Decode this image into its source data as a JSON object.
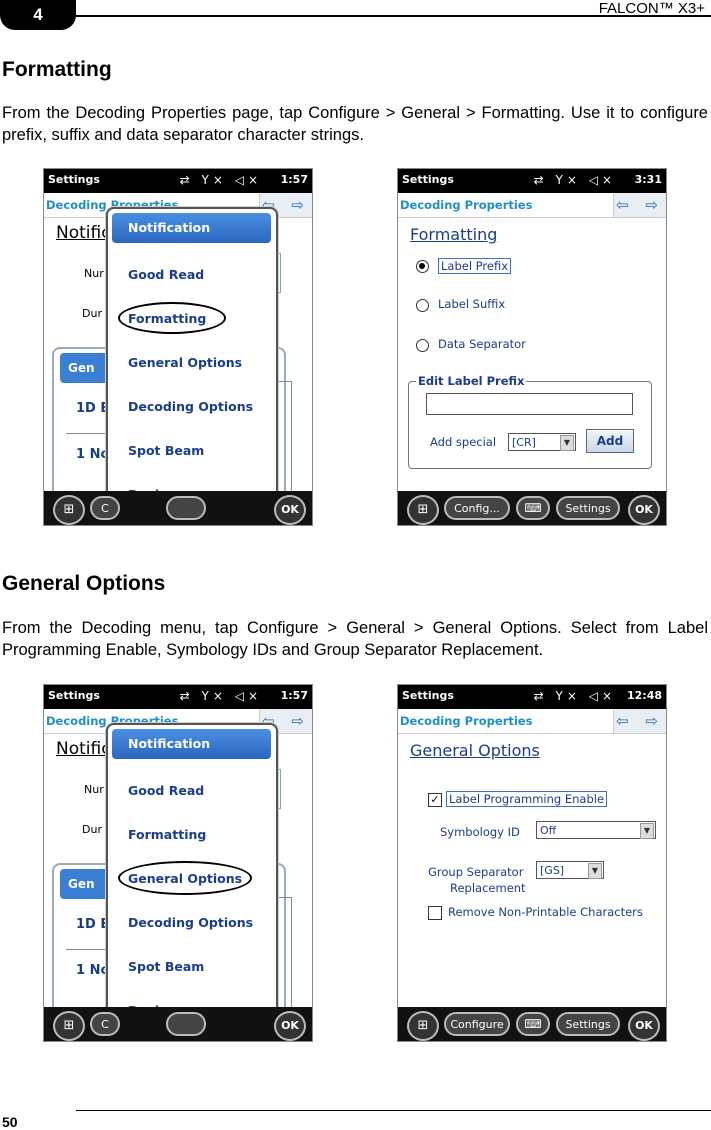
{
  "header": {
    "chapter": "4",
    "doc_title": "FALCON™ X3+"
  },
  "section1": {
    "heading": "Formatting",
    "body": "From the Decoding Properties page, tap Configure > General > Formatting. Use it to configure prefix, suffix and data separator character strings."
  },
  "section2": {
    "heading": "General Options",
    "body": "From the Decoding menu, tap Configure > General > General Options. Select from Label Programming Enable, Symbology IDs and Group Separator Replacement."
  },
  "device": {
    "app_title": "Settings",
    "subtitle": "Decoding Properties",
    "status_icons": "⇄ Y× ◁×",
    "nav_arrows": "⇦ ⇨",
    "start_icon": "⊞",
    "keyboard_icon": "⌨",
    "ok_label": "OK",
    "settings_label": "Settings"
  },
  "menu_screens": [
    {
      "time": "1:57",
      "bg_title": "Notific",
      "bg_num": "Nur",
      "bg_dur": "Dur",
      "bg_dialog_head": "Gen",
      "bg_row1": "1D E",
      "bg_row2": "1 No",
      "taskbar_left": "C",
      "items": [
        "Notification",
        "Good Read",
        "Formatting",
        "General Options",
        "Decoding Options",
        "Spot Beam",
        "Devices"
      ],
      "highlighted": "Notification",
      "circled": "Formatting"
    },
    {
      "time": "1:57",
      "bg_title": "Notific",
      "bg_num": "Nur",
      "bg_dur": "Dur",
      "bg_dialog_head": "Gen",
      "bg_row1": "1D E",
      "bg_row2": "1 No",
      "taskbar_left": "C",
      "items": [
        "Notification",
        "Good Read",
        "Formatting",
        "General Options",
        "Decoding Options",
        "Spot Beam",
        "Devices"
      ],
      "highlighted": "Notification",
      "circled": "General Options"
    }
  ],
  "formatting_screen": {
    "time": "3:31",
    "title": "Formatting",
    "options": [
      "Label Prefix",
      "Label Suffix",
      "Data Separator"
    ],
    "selected": "Label Prefix",
    "group_title": "Edit Label Prefix",
    "prefix_value": "",
    "add_special_label": "Add special",
    "add_special_value": "[CR]",
    "add_button": "Add",
    "taskbar_config": "Config..."
  },
  "general_screen": {
    "time": "12:48",
    "title": "General Options",
    "label_programming": "Label Programming Enable",
    "label_programming_checked": true,
    "symbology_label": "Symbology ID",
    "symbology_value": "Off",
    "group_sep_label1": "Group Separator",
    "group_sep_label2": "Replacement",
    "group_sep_value": "[GS]",
    "remove_np": "Remove Non-Printable Characters",
    "remove_np_checked": false,
    "taskbar_config": "Configure"
  },
  "footer": {
    "page_number": "50"
  }
}
